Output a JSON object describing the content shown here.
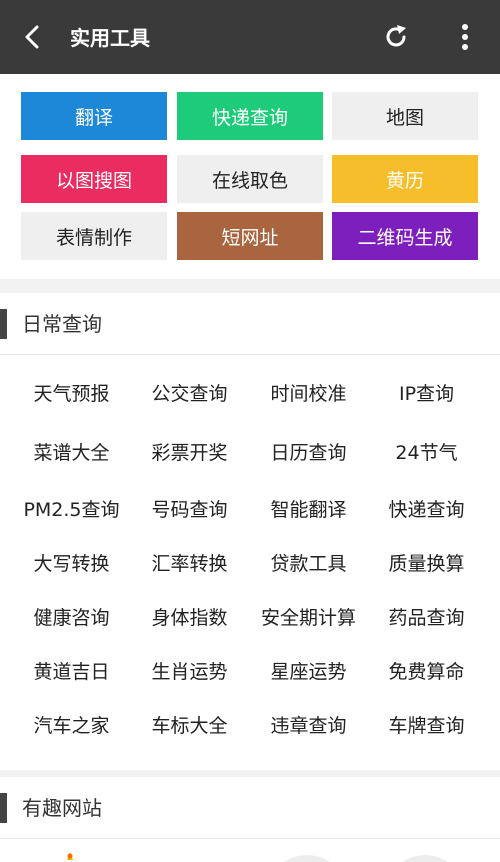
{
  "header": {
    "title": "实用工具"
  },
  "quick_tools": [
    {
      "label": "翻译",
      "bg": "#1e88d8",
      "fg": "#ffffff"
    },
    {
      "label": "快递查询",
      "bg": "#1ecb7a",
      "fg": "#ffffff"
    },
    {
      "label": "地图",
      "bg": "#efefef",
      "fg": "#222222"
    },
    {
      "label": "以图搜图",
      "bg": "#ea2c60",
      "fg": "#ffffff"
    },
    {
      "label": "在线取色",
      "bg": "#efefef",
      "fg": "#222222"
    },
    {
      "label": "黄历",
      "bg": "#f5be2a",
      "fg": "#ffffff"
    },
    {
      "label": "表情制作",
      "bg": "#efefef",
      "fg": "#222222"
    },
    {
      "label": "短网址",
      "bg": "#a96440",
      "fg": "#ffffff"
    },
    {
      "label": "二维码生成",
      "bg": "#7d1fbc",
      "fg": "#ffffff"
    }
  ],
  "daily": {
    "title": "日常查询",
    "items": [
      "天气预报",
      "公交查询",
      "时间校准",
      "IP查询",
      "菜谱大全",
      "彩票开奖",
      "日历查询",
      "24节气",
      "PM2.5查询",
      "号码查询",
      "智能翻译",
      "快递查询",
      "大写转换",
      "汇率转换",
      "贷款工具",
      "质量换算",
      "健康咨询",
      "身体指数",
      "安全期计算",
      "药品查询",
      "黄道吉日",
      "生肖运势",
      "星座运势",
      "免费算命",
      "汽车之家",
      "车标大全",
      "违章查询",
      "车牌查询"
    ]
  },
  "fun": {
    "title": "有趣网站"
  },
  "icons": {
    "back": "back-arrow-icon",
    "refresh": "refresh-icon",
    "more": "more-vertical-icon"
  }
}
